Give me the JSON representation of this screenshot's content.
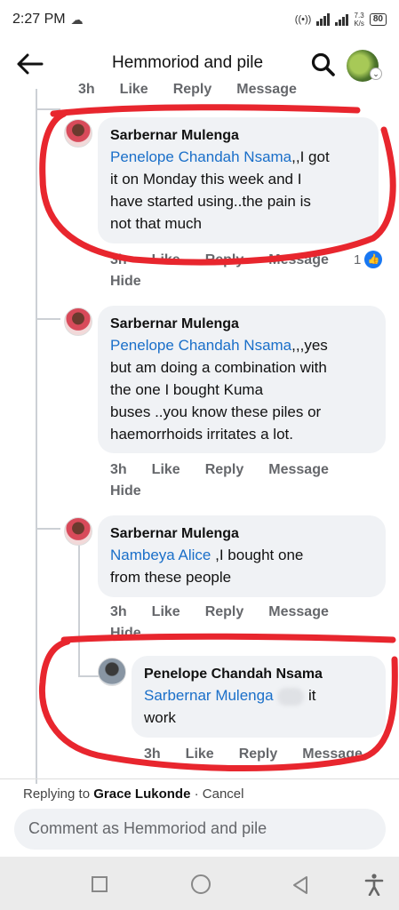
{
  "status_bar": {
    "time": "2:27 PM",
    "network_speed_top": "7.3",
    "network_speed_unit": "K/s",
    "battery": "80"
  },
  "header": {
    "title": "Hemmoriod and pile"
  },
  "thread": {
    "top_meta": {
      "time": "3h",
      "like": "Like",
      "reply": "Reply",
      "message": "Message"
    },
    "comments": [
      {
        "author": "Sarbernar Mulenga",
        "mention": "Penelope Chandah Nsama",
        "lines": [
          ",,I got",
          "it on Monday this week and I",
          "have started using..the pain is",
          "not that much"
        ],
        "time": "3h",
        "like": "Like",
        "reply": "Reply",
        "message": "Message",
        "reactions": "1",
        "hide": "Hide"
      },
      {
        "author": "Sarbernar Mulenga",
        "mention": "Penelope Chandah Nsama",
        "lines": [
          ",,,yes",
          "but am doing a combination with",
          "the one I bought Kuma",
          "buses ..you know these piles or",
          "haemorrhoids irritates a lot."
        ],
        "time": "3h",
        "like": "Like",
        "reply": "Reply",
        "message": "Message",
        "hide": "Hide"
      },
      {
        "author": "Sarbernar Mulenga",
        "mention": "Nambeya Alice",
        "lines": [
          " ,I bought one",
          "from these people"
        ],
        "time": "3h",
        "like": "Like",
        "reply": "Reply",
        "message": "Message",
        "hide": "Hide"
      },
      {
        "author": "Penelope Chandah Nsama",
        "mention": "Sarbernar Mulenga",
        "lines": [
          "it",
          "work"
        ],
        "time": "3h",
        "like": "Like",
        "reply": "Reply",
        "message": "Message"
      }
    ]
  },
  "reply_bar": {
    "prefix": "Replying to",
    "target": "Grace Lukonde",
    "separator": " · ",
    "cancel": "Cancel"
  },
  "composer": {
    "placeholder": "Comment as Hemmoriod and pile"
  },
  "colors": {
    "link": "#1a6fc9",
    "bubble": "#f0f2f5",
    "marker": "#e8262e",
    "meta_text": "#65676b"
  }
}
